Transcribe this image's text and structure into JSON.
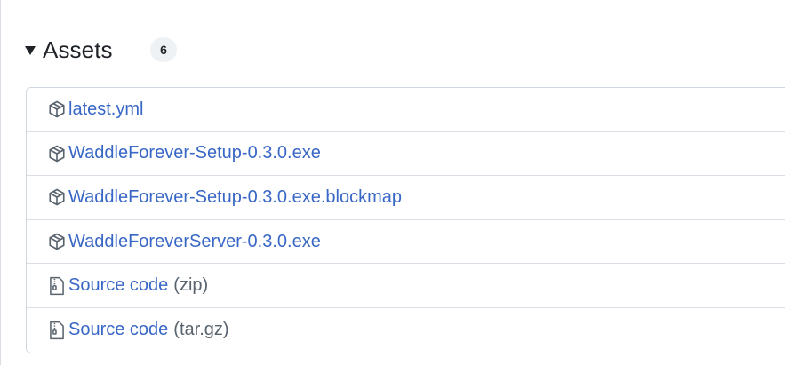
{
  "assets": {
    "title": "Assets",
    "count": "6",
    "items": [
      {
        "name": "latest.yml",
        "suffix": "",
        "icon": "package-icon"
      },
      {
        "name": "WaddleForever-Setup-0.3.0.exe",
        "suffix": "",
        "icon": "package-icon"
      },
      {
        "name": "WaddleForever-Setup-0.3.0.exe.blockmap",
        "suffix": "",
        "icon": "package-icon"
      },
      {
        "name": "WaddleForeverServer-0.3.0.exe",
        "suffix": "",
        "icon": "package-icon"
      },
      {
        "name": "Source code",
        "suffix": "(zip)",
        "icon": "file-zip-icon"
      },
      {
        "name": "Source code",
        "suffix": "(tar.gz)",
        "icon": "file-zip-icon"
      }
    ]
  },
  "colors": {
    "link": "#3867c6",
    "muted": "#59636e",
    "border": "#d0d7de",
    "badge_bg": "#eff2f5"
  }
}
